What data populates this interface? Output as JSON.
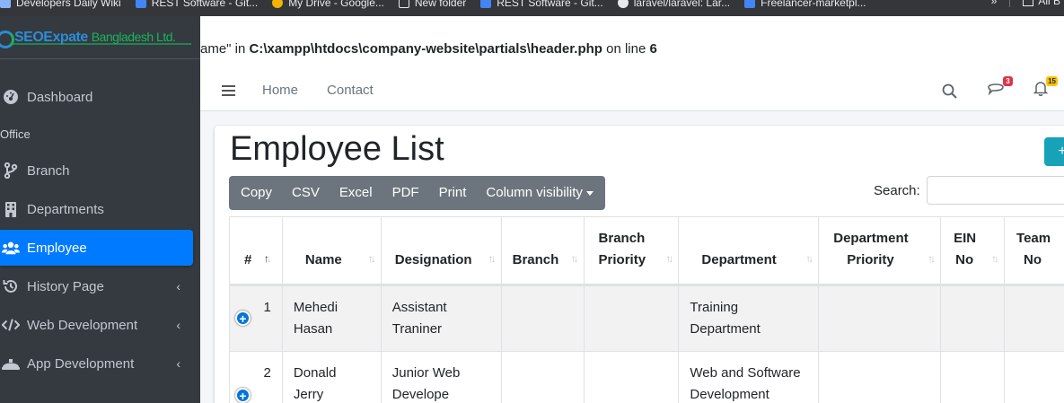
{
  "bookmarks": [
    {
      "label": "Developers Daily Wiki",
      "icon": "bookmark-icon"
    },
    {
      "label": "REST Software - Git...",
      "icon": "doc-icon"
    },
    {
      "label": "My Drive - Google...",
      "icon": "drive-icon"
    },
    {
      "label": "New folder",
      "icon": "folder-icon"
    },
    {
      "label": "REST Software - Git...",
      "icon": "doc-icon"
    },
    {
      "label": "laravel/laravel: Lar...",
      "icon": "github-icon"
    },
    {
      "label": "Freelancer-marketpl...",
      "icon": "doc-icon"
    }
  ],
  "bookmarks_right": {
    "overflow": "»",
    "all_label": "All B"
  },
  "brand": {
    "part1": "SEO",
    "part2": "Expate",
    "part3": "Bangladesh Ltd."
  },
  "sidebar": {
    "items": [
      {
        "label": "Dashboard",
        "icon": "dashboard-icon"
      },
      {
        "label": "Office",
        "header": true
      },
      {
        "label": "Branch",
        "icon": "branch-icon"
      },
      {
        "label": "Departments",
        "icon": "building-icon"
      },
      {
        "label": "Employee",
        "icon": "users-icon",
        "active": true
      },
      {
        "label": "History Page",
        "icon": "history-icon",
        "chevron": "‹"
      },
      {
        "label": "Web Development",
        "icon": "code-icon",
        "chevron": "‹"
      },
      {
        "label": "App Development",
        "icon": "hat-icon",
        "chevron": "‹"
      }
    ]
  },
  "warning": {
    "prefix": "ame\" in ",
    "path": "C:\\xampp\\htdocs\\company-website\\partials\\header.php",
    "mid": " on line ",
    "line": "6"
  },
  "topnav": {
    "links": [
      "Home",
      "Contact"
    ],
    "messages_count": "3",
    "notifications_count": "15"
  },
  "page": {
    "title": "Employee List",
    "add_button": "+",
    "export_buttons": [
      "Copy",
      "CSV",
      "Excel",
      "PDF",
      "Print",
      "Column visibility"
    ],
    "search_label": "Search:",
    "search_value": ""
  },
  "table": {
    "columns": [
      {
        "line1": "#",
        "line2": ""
      },
      {
        "line1": "Name",
        "line2": ""
      },
      {
        "line1": "Designation",
        "line2": ""
      },
      {
        "line1": "Branch",
        "line2": ""
      },
      {
        "line1": "Branch",
        "line2": "Priority"
      },
      {
        "line1": "Department",
        "line2": ""
      },
      {
        "line1": "Department",
        "line2": "Priority"
      },
      {
        "line1": "EIN",
        "line2": "No"
      },
      {
        "line1": "Team",
        "line2": "No"
      }
    ],
    "rows": [
      {
        "index": "1",
        "name_line1": "Mehedi",
        "name_line2": "Hasan",
        "designation_line1": "Assistant",
        "designation_line2": "Traniner",
        "branch": "",
        "branch_priority": "",
        "department_line1": "Training",
        "department_line2": "Department",
        "department_priority": "",
        "ein": "",
        "team": ""
      },
      {
        "index": "2",
        "name_line1": "Donald",
        "name_line2": "Jerry",
        "designation_line1": "Junior Web",
        "designation_line2": "Develope",
        "branch": "",
        "branch_priority": "",
        "department_line1": "Web and Software",
        "department_line2": "Development",
        "department_priority": "",
        "ein": "",
        "team": ""
      }
    ]
  },
  "colors": {
    "sidebar_bg": "#343a40",
    "active": "#007bff",
    "button_gray": "#6c757d",
    "info": "#17a2b8"
  }
}
